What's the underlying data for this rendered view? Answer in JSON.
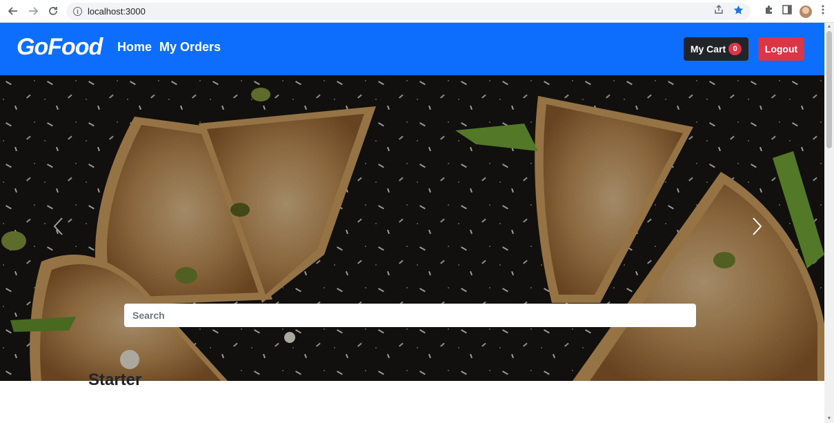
{
  "browser": {
    "url": "localhost:3000",
    "icons": {
      "back": "arrow-left-icon",
      "forward": "arrow-right-icon",
      "reload": "reload-icon",
      "info": "info-icon",
      "share": "share-icon",
      "bookmark": "star-icon",
      "extensions": "puzzle-icon",
      "sidepanel": "side-panel-icon",
      "profile": "avatar",
      "menu": "kebab-menu-icon"
    }
  },
  "navbar": {
    "brand": "GoFood",
    "links": [
      "Home",
      "My Orders"
    ],
    "cart_label": "My Cart",
    "cart_count": "0",
    "logout_label": "Logout",
    "color": "#0d6efd"
  },
  "carousel": {
    "search_placeholder": "Search",
    "prev_icon": "chevron-left-icon",
    "next_icon": "chevron-right-icon"
  },
  "main": {
    "section_title": "Starter"
  },
  "colors": {
    "primary": "#0d6efd",
    "dark": "#212529",
    "danger": "#dc3545"
  }
}
